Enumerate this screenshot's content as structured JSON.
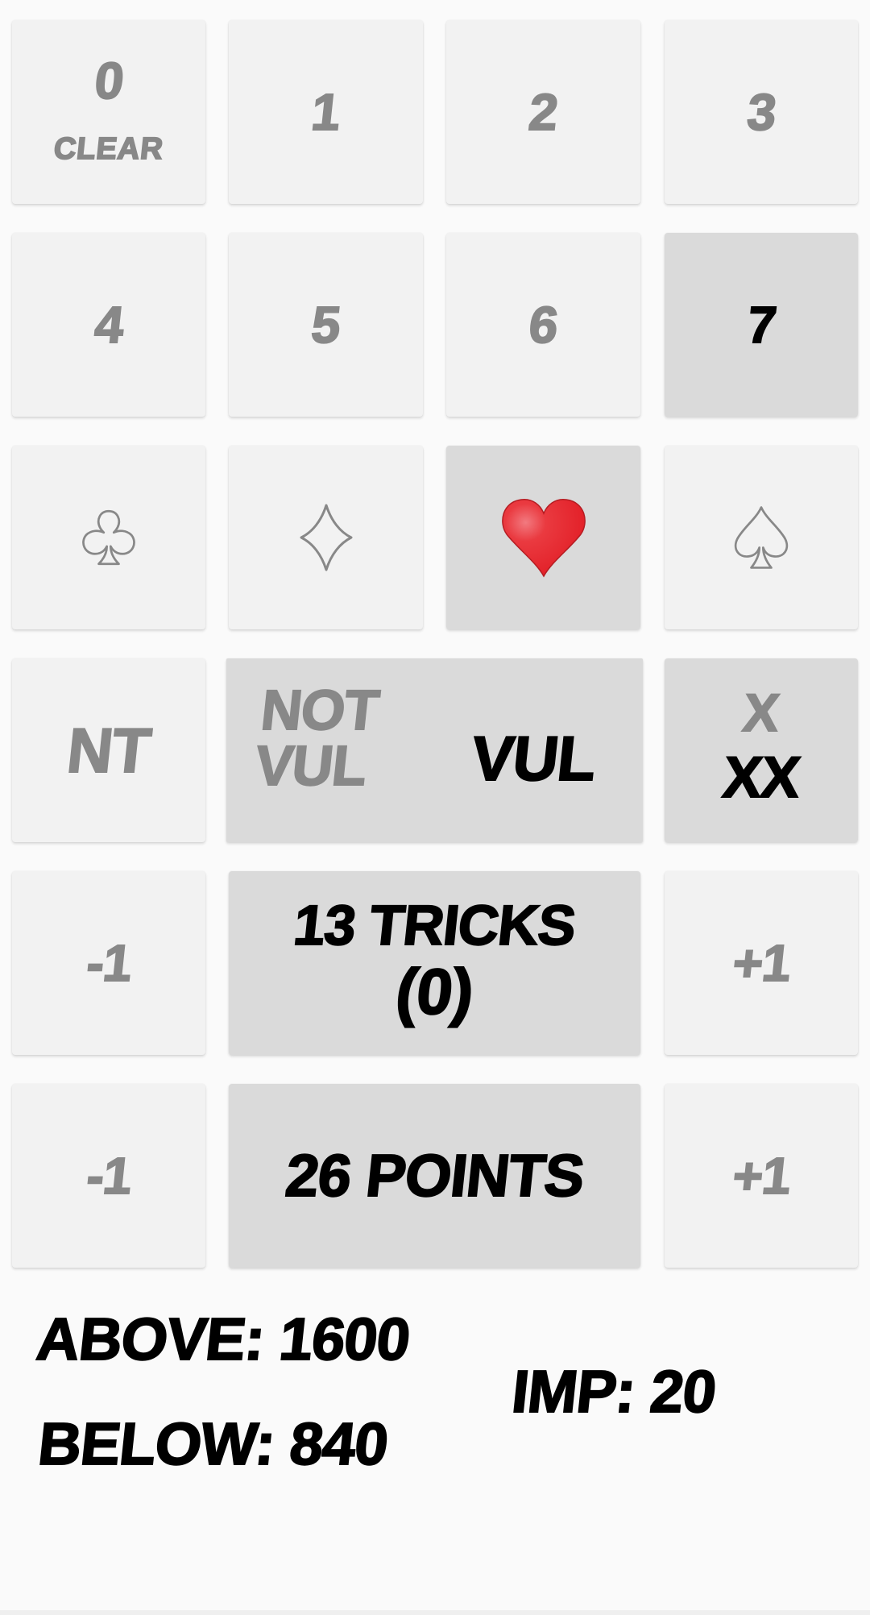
{
  "colors": {
    "page_background": "#fafafa",
    "card_background": "#f2f2f2",
    "card_selected_background": "#dadada",
    "inactive_text": "#888888",
    "active_text": "#000000",
    "heart_red": "#e8262d"
  },
  "level_buttons": [
    {
      "label": "0",
      "sublabel": "CLEAR",
      "selected": false
    },
    {
      "label": "1",
      "selected": false
    },
    {
      "label": "2",
      "selected": false
    },
    {
      "label": "3",
      "selected": false
    },
    {
      "label": "4",
      "selected": false
    },
    {
      "label": "5",
      "selected": false
    },
    {
      "label": "6",
      "selected": false
    },
    {
      "label": "7",
      "selected": true
    }
  ],
  "suit_buttons": [
    {
      "name": "clubs",
      "icon": "club-icon",
      "selected": false
    },
    {
      "name": "diamonds",
      "icon": "diamond-icon",
      "selected": false
    },
    {
      "name": "hearts",
      "icon": "heart-icon",
      "selected": true
    },
    {
      "name": "spades",
      "icon": "spade-icon",
      "selected": false
    }
  ],
  "notrump_button": {
    "label": "NT",
    "selected": false
  },
  "vulnerability": {
    "options": [
      {
        "label_line1": "NOT",
        "label_line2": "VUL",
        "selected": false
      },
      {
        "label": "VUL",
        "selected": true
      }
    ]
  },
  "doubling": {
    "options": [
      {
        "label": "X",
        "selected": false
      },
      {
        "label": "XX",
        "selected": true
      }
    ]
  },
  "tricks": {
    "decrement_label": "-1",
    "increment_label": "+1",
    "label": "13 TRICKS",
    "sub_label": "(0)",
    "value": 13,
    "over_under": 0
  },
  "points": {
    "decrement_label": "-1",
    "increment_label": "+1",
    "label": "26 POINTS",
    "value": 26
  },
  "scores": {
    "above": "ABOVE: 1600",
    "below": "BELOW: 840",
    "imp": "IMP: 20",
    "above_value": 1600,
    "below_value": 840,
    "imp_value": 20
  }
}
